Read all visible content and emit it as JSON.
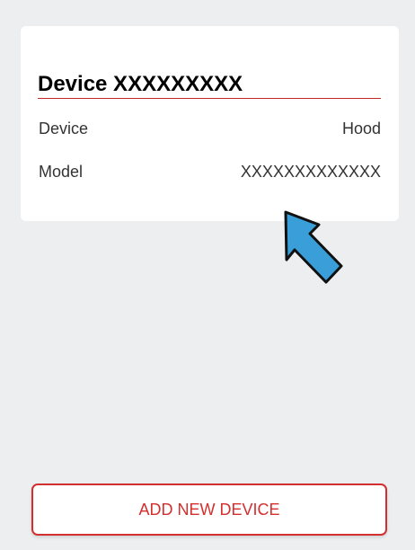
{
  "device_card": {
    "title": "Device XXXXXXXXX",
    "rows": [
      {
        "label": "Device",
        "value": "Hood"
      },
      {
        "label": "Model",
        "value": "XXXXXXXXXXXXX"
      }
    ]
  },
  "annotation": {
    "arrow_icon": "arrow-pointer-icon",
    "arrow_color": "#3a9fd8"
  },
  "footer": {
    "add_device_label": "ADD NEW DEVICE"
  },
  "colors": {
    "accent": "#d32f2f",
    "background": "#eceef0"
  }
}
